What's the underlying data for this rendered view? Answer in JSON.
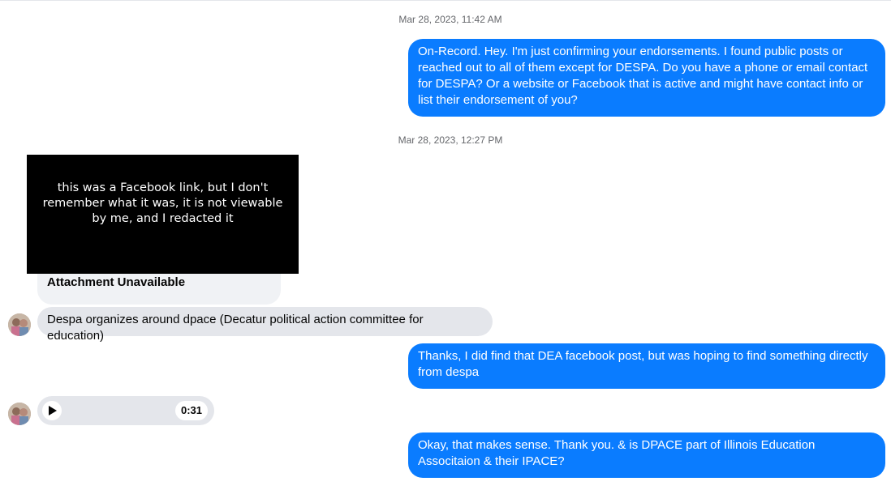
{
  "conversation": {
    "timestamps": [
      "Mar 28, 2023, 11:42 AM",
      "Mar 28, 2023, 12:27 PM"
    ],
    "messages": {
      "m1": "On-Record. Hey. I'm just confirming your endorsements. I found public posts or reached out to all of them except for DESPA. Do you have a phone or email contact for DESPA? Or a website or Facebook that is active and might have contact info or list their endorsement of you?",
      "redaction_note": "this was a Facebook link, but I don't remember what it was, it is not viewable by me, and I redacted it",
      "attachment_label": "Attachment Unavailable",
      "m2": "Despa organizes around dpace (Decatur political action committee for education)",
      "m3": "Thanks, I did find that DEA facebook post, but was hoping to find something directly from despa",
      "audio_duration": "0:31",
      "m4": "Okay, that makes sense. Thank you. & is DPACE part of Illinois Education Associtaion & their IPACE?"
    }
  },
  "colors": {
    "outgoing_bubble": "#0a7cff",
    "incoming_bubble": "#e4e6eb",
    "timestamp_text": "#65676b"
  },
  "icons": [
    "avatar",
    "play-icon"
  ]
}
